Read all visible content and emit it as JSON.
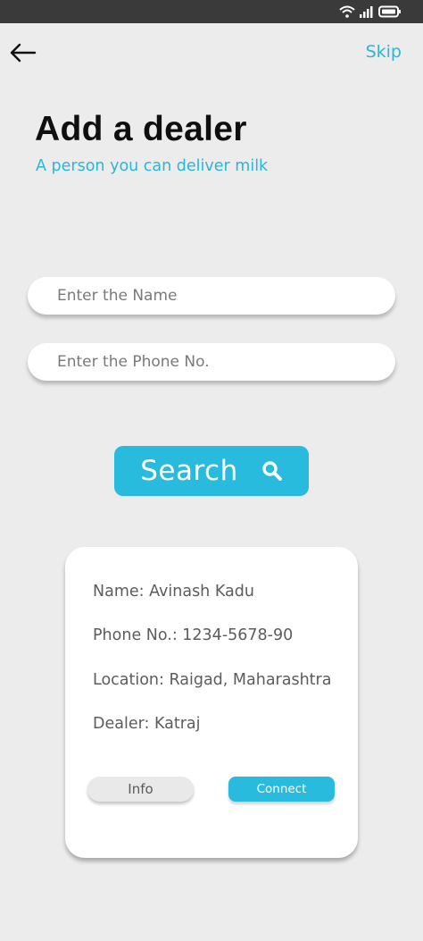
{
  "header": {
    "skip_label": "Skip",
    "title": "Add a dealer",
    "subtitle": "A person you can deliver milk"
  },
  "form": {
    "name_placeholder": "Enter the Name",
    "phone_placeholder": "Enter the Phone No.",
    "search_label": "Search"
  },
  "result_card": {
    "name_line": "Name: Avinash Kadu",
    "phone_line": "Phone No.: 1234-5678-90",
    "location_line": "Location: Raigad, Maharashtra",
    "dealer_line": "Dealer: Katraj",
    "info_label": "Info",
    "connect_label": "Connect"
  },
  "icons": {
    "back": "arrow-left-icon",
    "search": "magnifier-icon",
    "wifi": "wifi-icon",
    "signal": "signal-icon",
    "battery": "battery-icon"
  },
  "colors": {
    "accent": "#29bbde",
    "background": "#ececec",
    "status_bar": "#3a3a3a"
  }
}
